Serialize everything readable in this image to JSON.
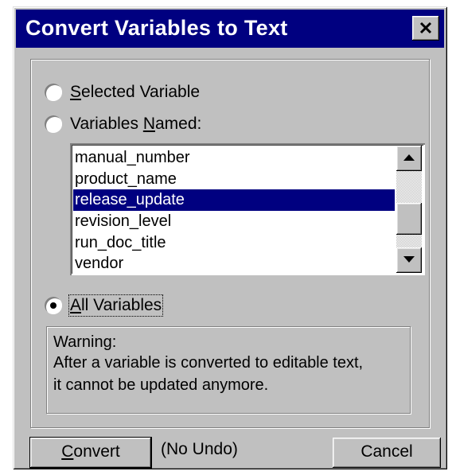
{
  "dialog": {
    "title": "Convert Variables to Text",
    "close_glyph": "close-icon"
  },
  "options": {
    "selected_variable": {
      "pre": "",
      "accel": "S",
      "post": "elected Variable",
      "checked": false
    },
    "variables_named": {
      "pre": "Variables ",
      "accel": "N",
      "post": "amed:",
      "checked": false
    },
    "all_variables": {
      "pre": "",
      "accel": "A",
      "post": "ll Variables",
      "checked": true
    }
  },
  "variable_list": {
    "items": [
      "manual_number",
      "product_name",
      "release_update",
      "revision_level",
      "run_doc_title",
      "vendor"
    ],
    "selected": "release_update"
  },
  "warning": {
    "line1": "Warning:",
    "line2": "After a variable is converted to editable text,",
    "line3": "it cannot be updated anymore."
  },
  "buttons": {
    "convert": {
      "accel": "C",
      "rest": "onvert"
    },
    "no_undo": "(No Undo)",
    "cancel": "Cancel"
  },
  "colors": {
    "title_bar": "#000080",
    "face": "#c0c0c0",
    "selection": "#000080"
  }
}
